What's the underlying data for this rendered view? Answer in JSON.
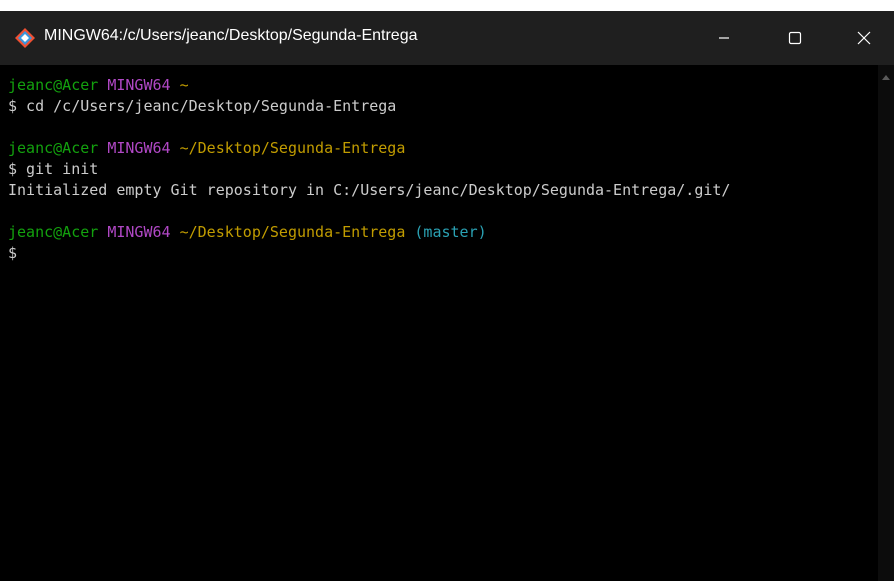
{
  "top_strip_text": "                 ",
  "window": {
    "title": "MINGW64:/c/Users/jeanc/Desktop/Segunda-Entrega",
    "app_icon": "git-bash-icon"
  },
  "controls": {
    "minimize_icon": "minimize-icon",
    "maximize_icon": "maximize-icon",
    "close_icon": "close-icon"
  },
  "terminal": {
    "block1": {
      "user": "jeanc@Acer",
      "system": "MINGW64",
      "path": "~",
      "command": "$ cd /c/Users/jeanc/Desktop/Segunda-Entrega"
    },
    "block2": {
      "user": "jeanc@Acer",
      "system": "MINGW64",
      "path": "~/Desktop/Segunda-Entrega",
      "command": "$ git init",
      "output": "Initialized empty Git repository in C:/Users/jeanc/Desktop/Segunda-Entrega/.git/"
    },
    "block3": {
      "user": "jeanc@Acer",
      "system": "MINGW64",
      "path": "~/Desktop/Segunda-Entrega",
      "branch": "(master)",
      "prompt": "$"
    }
  },
  "colors": {
    "user": "#13a10e",
    "system": "#b148c6",
    "path": "#c19c00",
    "branch": "#2aa1b3",
    "text": "#cccccc",
    "titlebar": "#1f1f1f",
    "background": "#000000"
  }
}
